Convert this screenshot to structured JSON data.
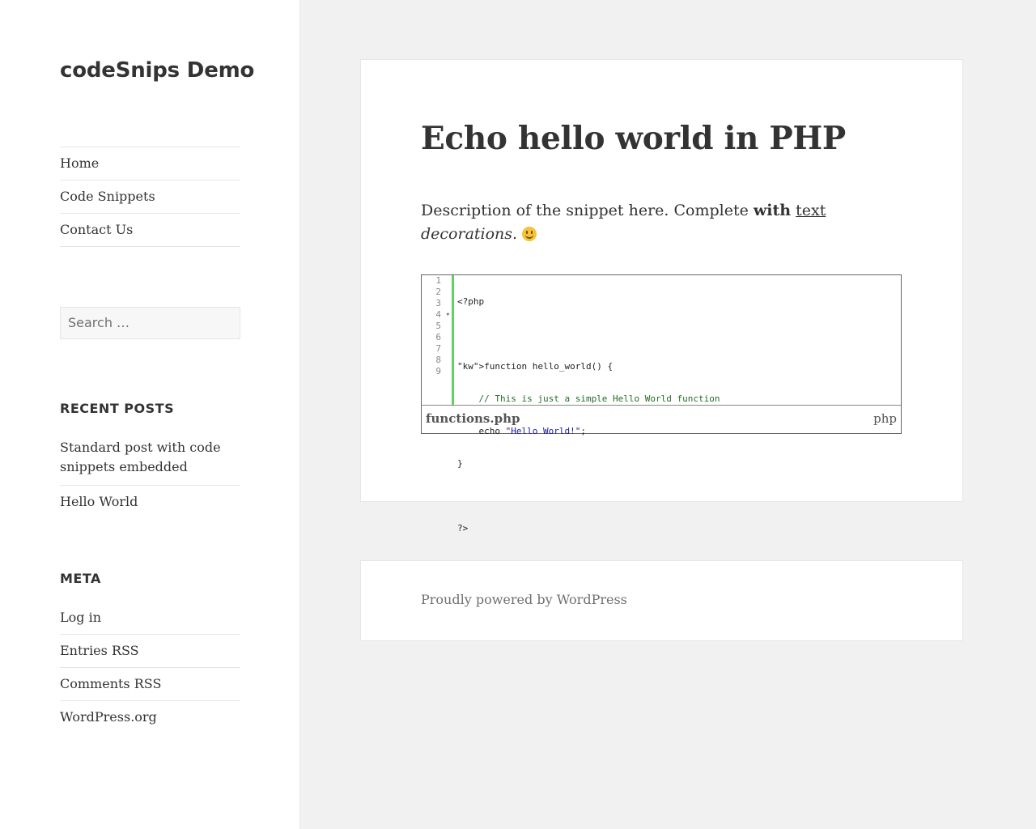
{
  "site": {
    "title": "codeSnips Demo"
  },
  "menu": [
    {
      "label": "Home"
    },
    {
      "label": "Code Snippets"
    },
    {
      "label": "Contact Us"
    }
  ],
  "search": {
    "placeholder": "Search …"
  },
  "recent_posts": {
    "title": "RECENT POSTS",
    "items": [
      {
        "label": "Standard post with code snippets embedded"
      },
      {
        "label": "Hello World"
      }
    ]
  },
  "meta": {
    "title": "META",
    "items": [
      {
        "label": "Log in"
      },
      {
        "label": "Entries RSS"
      },
      {
        "label": "Comments RSS"
      },
      {
        "label": "WordPress.org"
      }
    ]
  },
  "post": {
    "title": "Echo hello world in PHP",
    "desc_plain": "Description of the snippet here. Complete ",
    "desc_bold": "with",
    "desc_underline": "text",
    "desc_italic": "decorations.",
    "emoji": "slightly-smiling-face"
  },
  "snippet": {
    "line_numbers": [
      "1",
      "2",
      "3",
      "4",
      "5",
      "6",
      "7",
      "8",
      "9"
    ],
    "lines": [
      "<?php",
      "",
      "function hello_world() {",
      "    // This is just a simple Hello World function",
      "    echo \"Hello World!\";",
      "}",
      "",
      "?>",
      ""
    ],
    "filename": "functions.php",
    "language": "php",
    "gutter_accent_color": "#5fd35f"
  },
  "footer": {
    "text": "Proudly powered by WordPress"
  }
}
